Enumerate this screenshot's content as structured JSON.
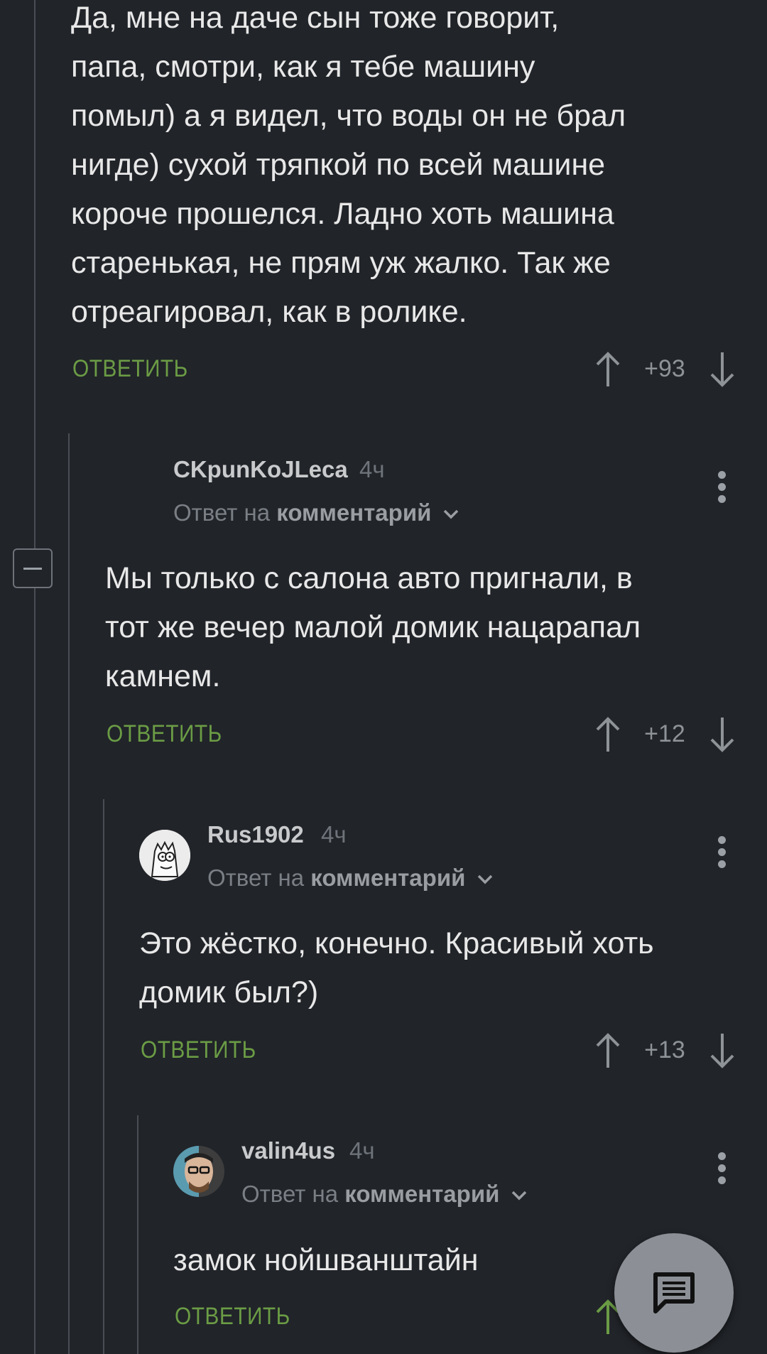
{
  "comments": [
    {
      "text": "Да, мне на даче сын тоже говорит,\nпапа, смотри, как я тебе машину\nпомыл) а я видел, что воды он не брал\nнигде) сухой тряпкой по всей машине\nкороче прошелся. Ладно хоть машина\nстаренькая, не прям уж жалко. Так же\nотреагировал, как в ролике.",
      "reply_label": "ОТВЕТИТЬ",
      "rating": "+93"
    },
    {
      "author": "CKpunKoJLeca",
      "time": "4ч",
      "reply_to_prefix": "Ответ на",
      "reply_to_link": "комментарий",
      "text": "Мы только с салона авто пригнали, в\nтот же вечер малой домик нацарапал\nкамнем.",
      "reply_label": "ОТВЕТИТЬ",
      "rating": "+12"
    },
    {
      "author": "Rus1902",
      "time": "4ч",
      "reply_to_prefix": "Ответ на",
      "reply_to_link": "комментарий",
      "text": "Это жёстко, конечно. Красивый хоть\nдомик был?)",
      "reply_label": "ОТВЕТИТЬ",
      "rating": "+13"
    },
    {
      "author": "valin4us",
      "time": "4ч",
      "reply_to_prefix": "Ответ на",
      "reply_to_link": "комментарий",
      "text": "замок нойшванштайн",
      "reply_label": "ОТВЕТИТЬ"
    }
  ],
  "icons": {
    "up": "arrow-up-icon",
    "down": "arrow-down-icon",
    "more": "more-vertical-icon",
    "fab": "comment-icon",
    "collapse": "minus-icon"
  },
  "colors": {
    "background": "#212429",
    "reply_green": "#6b9c45",
    "text": "#e8e8e8",
    "fab": "#8c9096"
  }
}
